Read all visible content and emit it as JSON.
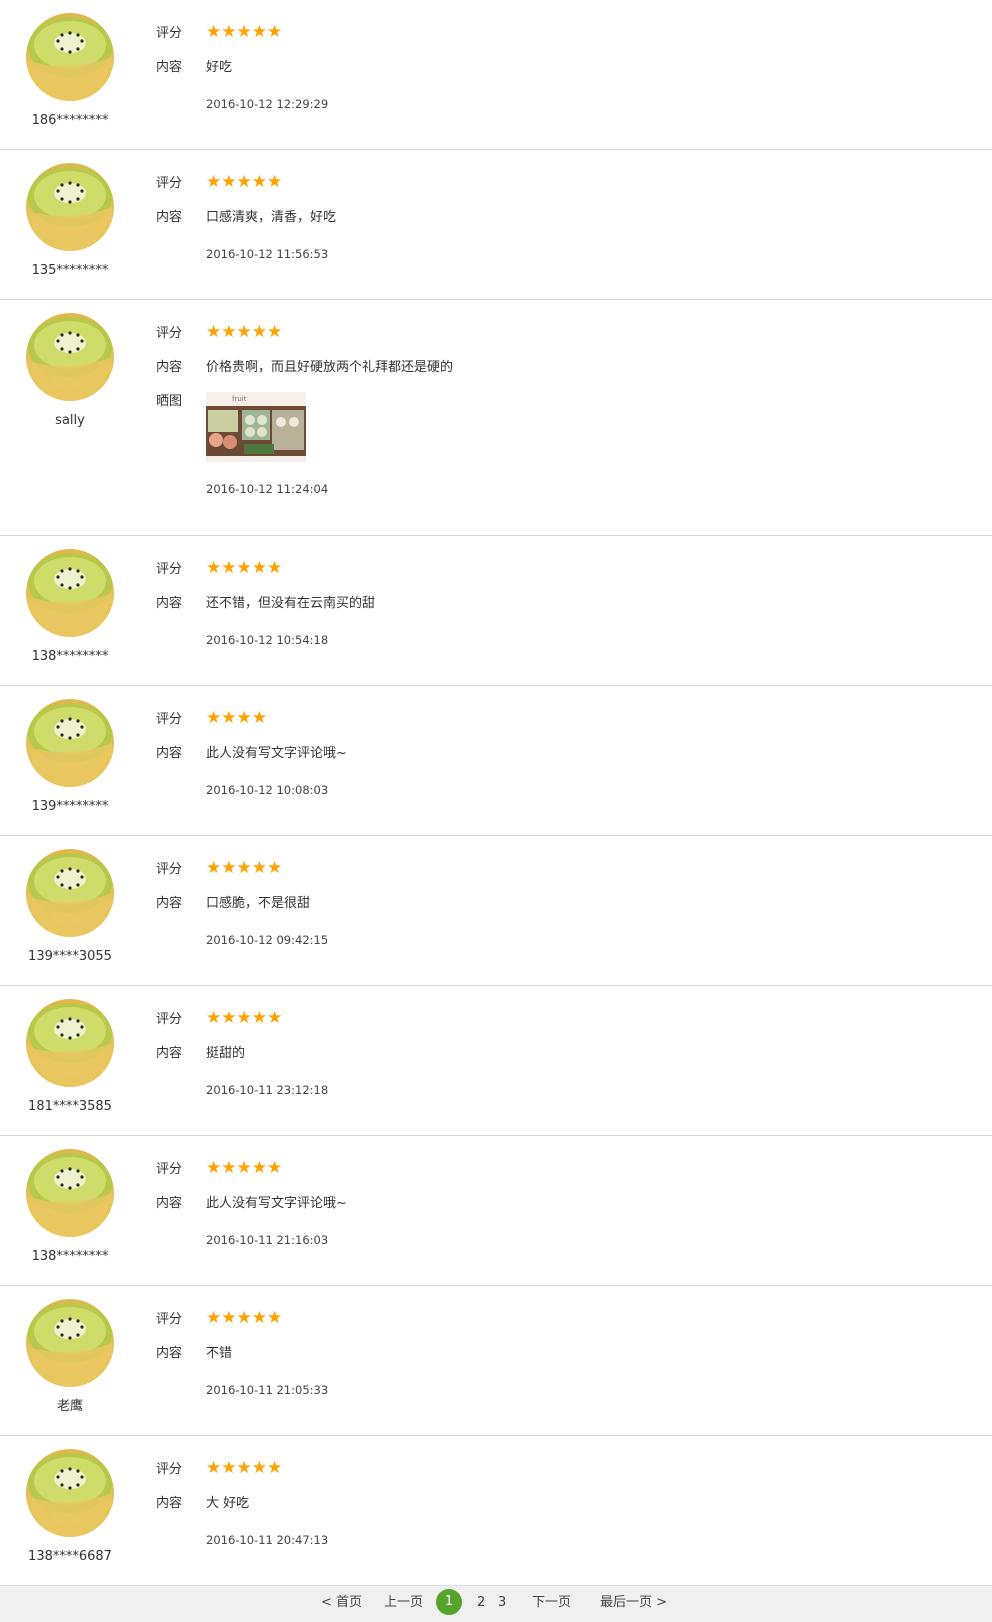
{
  "labels": {
    "rating": "评分",
    "content": "内容",
    "photos": "晒图"
  },
  "star_glyph": "★",
  "colors": {
    "star": "#ffa200",
    "pager_active": "#54a32a",
    "divider": "#d6d6d6"
  },
  "avatar_icon": "kiwi-fruit-icon",
  "reviews": [
    {
      "user": "186********",
      "stars": 5,
      "content": "好吃",
      "time": "2016-10-12 12:29:29"
    },
    {
      "user": "135********",
      "stars": 5,
      "content": "口感清爽，清香，好吃",
      "time": "2016-10-12 11:56:53"
    },
    {
      "user": "sally",
      "stars": 5,
      "content": "价格贵啊，而且好硬放两个礼拜都还是硬的",
      "time": "2016-10-12 11:24:04",
      "photo_caption": "fruit"
    },
    {
      "user": "138********",
      "stars": 5,
      "content": "还不错，但没有在云南买的甜",
      "time": "2016-10-12 10:54:18"
    },
    {
      "user": "139********",
      "stars": 4,
      "content": "此人没有写文字评论哦~",
      "time": "2016-10-12 10:08:03"
    },
    {
      "user": "139****3055",
      "stars": 5,
      "content": "口感脆，不是很甜",
      "time": "2016-10-12 09:42:15"
    },
    {
      "user": "181****3585",
      "stars": 5,
      "content": "挺甜的",
      "time": "2016-10-11 23:12:18"
    },
    {
      "user": "138********",
      "stars": 5,
      "content": "此人没有写文字评论哦~",
      "time": "2016-10-11 21:16:03"
    },
    {
      "user": "老鹰",
      "stars": 5,
      "content": "不错",
      "time": "2016-10-11 21:05:33"
    },
    {
      "user": "138****6687",
      "stars": 5,
      "content": "大 好吃",
      "time": "2016-10-11 20:47:13"
    }
  ],
  "pagination": {
    "first": "< 首页",
    "prev": "上一页",
    "pages": [
      "1",
      "2",
      "3"
    ],
    "current": "1",
    "next": "下一页",
    "last": "最后一页 >"
  }
}
